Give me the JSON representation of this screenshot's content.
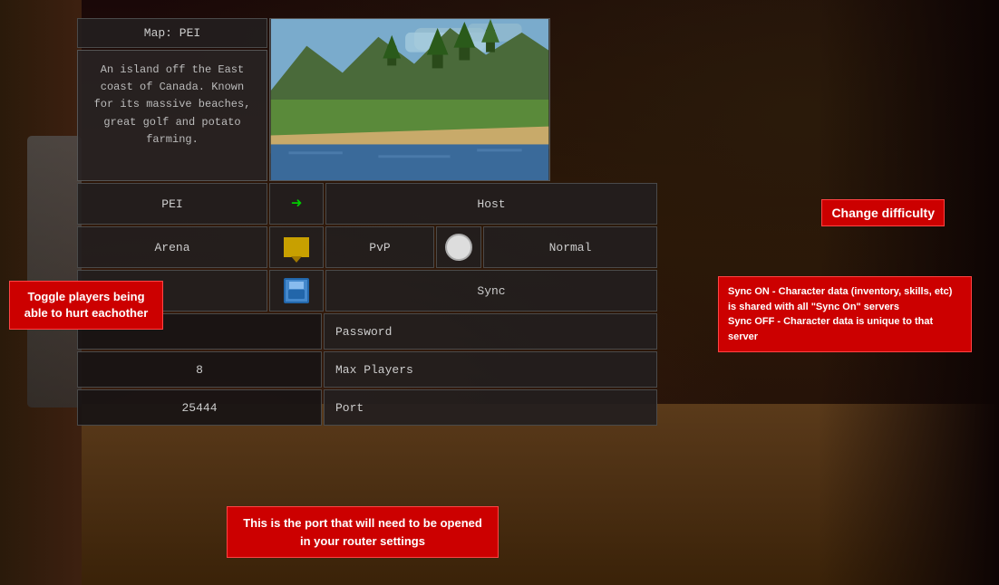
{
  "background": {
    "desc": "Dark game environment background"
  },
  "map": {
    "title": "Map: PEI",
    "description": "An island off the East coast of Canada. Known for its massive beaches, great golf and potato farming.",
    "name": "PEI",
    "arena": "Arena"
  },
  "server": {
    "host_label": "Host",
    "pvp_label": "PvP",
    "difficulty_label": "Normal",
    "sync_label": "Sync",
    "password_label": "Password",
    "max_players_label": "Max Players",
    "max_players_value": "8",
    "port_label": "Port",
    "port_value": "25444"
  },
  "annotations": {
    "change_difficulty": "Change difficulty",
    "toggle_pvp": "Toggle players being able to hurt eachother",
    "sync_description": "Sync ON - Character data (inventory, skills, etc) is shared with all \"Sync On\" servers\nSync OFF - Character data is unique to that server",
    "port_info": "This is the port that will need to be opened in your router settings"
  }
}
